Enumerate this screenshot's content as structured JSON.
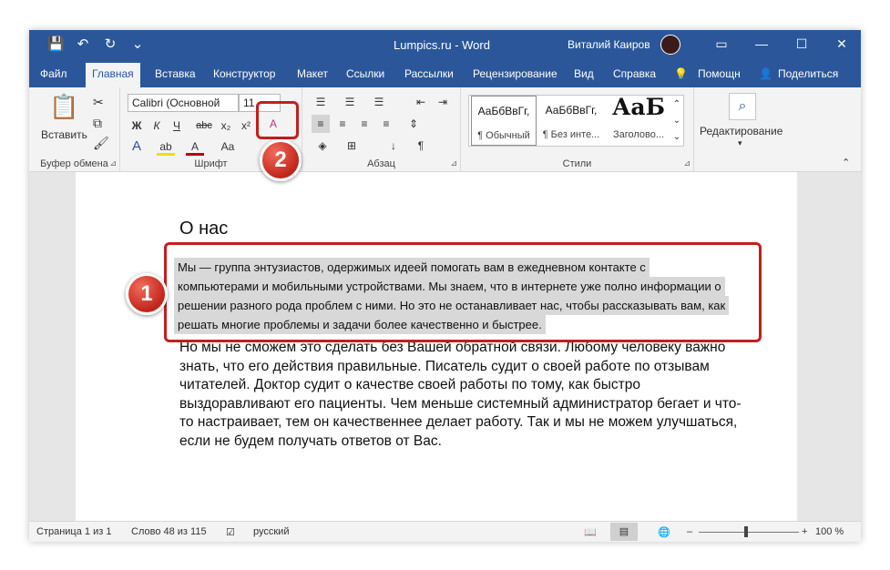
{
  "titlebar": {
    "title": "Lumpics.ru - Word",
    "user": "Виталий Каиров",
    "qat": {
      "save_icon": "💾",
      "undo_icon": "↶",
      "redo_icon": "↻",
      "customize_icon": "⌄"
    },
    "controls": {
      "ribbon_options_icon": "▭",
      "minimize_icon": "—",
      "maximize_icon": "☐",
      "close_icon": "✕"
    }
  },
  "tabs": [
    "Файл",
    "Главная",
    "Вставка",
    "Конструктор",
    "Макет",
    "Ссылки",
    "Рассылки",
    "Рецензирование",
    "Вид",
    "Справка",
    "Помощн",
    "Поделиться"
  ],
  "ribbon": {
    "clipboard": {
      "label": "Буфер обмена",
      "paste_label": "Вставить",
      "paste_icon": "📋",
      "cut_icon": "✂",
      "copy_icon": "⧉",
      "format_painter_icon": "🖌"
    },
    "font": {
      "label": "Шрифт",
      "font_name": "Calibri (Основной",
      "font_size": "11",
      "bold": "Ж",
      "italic": "К",
      "underline": "Ч",
      "strike": "abc",
      "subscript": "x₂",
      "superscript": "x²",
      "text_effects": "A",
      "highlight": "ab",
      "font_color": "A",
      "change_case": "Aa",
      "clear_format_icon": "A"
    },
    "paragraph": {
      "label": "Абзац",
      "shading_icon": "◈",
      "borders_icon": "⊞",
      "sort_icon": "↓",
      "marks_icon": "¶"
    },
    "styles": {
      "label": "Стили",
      "items": [
        {
          "preview": "АаБбВвГг,",
          "name": "¶ Обычный"
        },
        {
          "preview": "АаБбВвГг,",
          "name": "¶ Без инте..."
        },
        {
          "preview": "АаБ",
          "name": "Заголово..."
        }
      ]
    },
    "editing": {
      "label": "Редактирование",
      "search_icon": "⌕"
    },
    "tell_me_icon": "💡",
    "share_icon": "👤",
    "collapse_icon": "⌃"
  },
  "document": {
    "heading": "О нас",
    "selected_lines": [
      "Мы — группа энтузиастов, одержимых идеей помогать вам в ежедневном контакте с",
      "компьютерами и мобильными устройствами. Мы знаем, что в интернете уже полно информации о",
      "решении разного рода проблем с ними. Но это не останавливает нас, чтобы рассказывать вам, как",
      "решать многие проблемы и задачи более качественно и быстрее."
    ],
    "body": "Но мы не сможем это сделать без Вашей обратной связи. Любому человеку важно знать, что его действия правильные. Писатель судит о своей работе по отзывам читателей. Доктор судит о качестве своей работы по тому, как быстро выздоравливают его пациенты. Чем меньше системный администратор бегает и что-то настраивает, тем он качественнее делает работу. Так и мы не можем улучшаться, если не будем получать ответов от Вас."
  },
  "status": {
    "page": "Страница 1 из 1",
    "words": "Слово 48 из 115",
    "language": "русский",
    "proof_icon": "☑",
    "read_mode_icon": "📖",
    "print_layout_icon": "▤",
    "web_layout_icon": "🌐",
    "zoom_minus": "–",
    "zoom_plus": "+",
    "zoom": "100 %",
    "zoom_level_percent": 100
  },
  "callouts": {
    "badge1": "1",
    "badge2": "2"
  },
  "colors": {
    "accent": "#2b579a",
    "callout": "#c41e1e",
    "selection": "#d8d8d8"
  }
}
